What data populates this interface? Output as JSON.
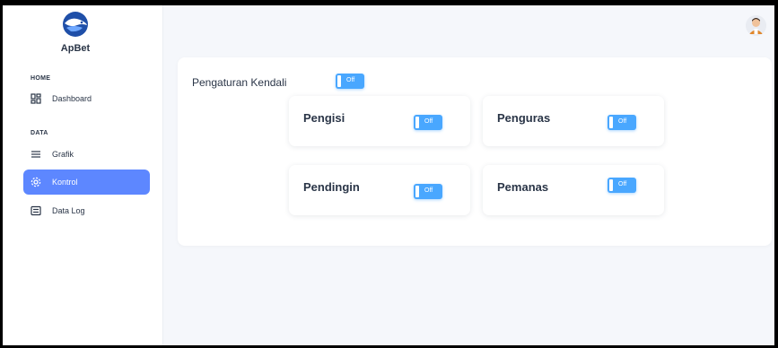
{
  "app": {
    "name": "ApBet"
  },
  "sidebar": {
    "sections": [
      {
        "title": "HOME",
        "items": [
          {
            "label": "Dashboard",
            "icon": "dashboard-icon"
          }
        ]
      },
      {
        "title": "DATA",
        "items": [
          {
            "label": "Grafik",
            "icon": "list-icon"
          },
          {
            "label": "Kontrol",
            "icon": "gear-icon",
            "active": true
          },
          {
            "label": "Data Log",
            "icon": "table-icon"
          }
        ]
      }
    ]
  },
  "header": {
    "avatar": "user-avatar"
  },
  "control": {
    "title": "Pengaturan Kendali",
    "master_toggle": "Off",
    "devices": [
      {
        "label": "Pengisi",
        "state": "Off"
      },
      {
        "label": "Penguras",
        "state": "Off"
      },
      {
        "label": "Pendingin",
        "state": "Off"
      },
      {
        "label": "Pemanas",
        "state": "Off"
      }
    ]
  },
  "colors": {
    "accent": "#5d87ff",
    "toggle": "#49a7ff",
    "text": "#2a3547"
  }
}
